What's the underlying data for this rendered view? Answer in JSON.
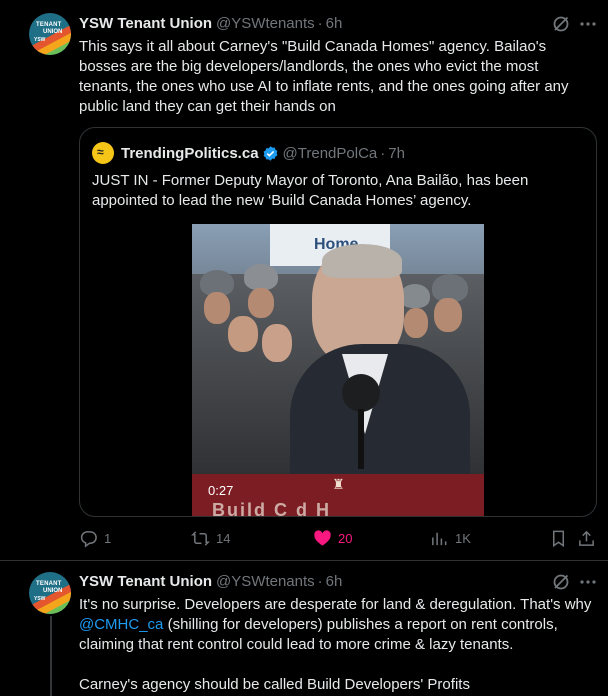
{
  "tweets": [
    {
      "author_name": "YSW Tenant Union",
      "handle": "@YSWtenants",
      "separator": "·",
      "time": "6h",
      "avatar_text": [
        "TENANT",
        "UNION",
        "YSW"
      ],
      "text": "This says it all about Carney's \"Build Canada Homes\" agency. Bailao's bosses are the big developers/landlords, the ones who evict the most tenants, the ones who use AI to inflate rents, and the ones going after any public land they can get their hands on",
      "quote": {
        "author_name": "TrendingPolitics.ca",
        "handle": "@TrendPolCa",
        "separator": "·",
        "time": "7h",
        "text": "JUST IN - Former Deputy Mayor of Toronto, Ana Bailão, has been appointed to lead the new ‘Build Canada Homes’ agency.",
        "video": {
          "duration": "0:27",
          "sign_text": "Home",
          "podium_text": "Build C  d  H"
        }
      },
      "actions": {
        "replies": "1",
        "reposts": "14",
        "likes": "20",
        "views": "1K"
      },
      "colors": {
        "like": "#f91880",
        "link": "#1d9bf0"
      },
      "icons": [
        "grok-icon",
        "more-icon",
        "reply-icon",
        "repost-icon",
        "heart-icon",
        "views-icon",
        "bookmark-icon",
        "share-icon",
        "verified-icon"
      ]
    },
    {
      "author_name": "YSW Tenant Union",
      "handle": "@YSWtenants",
      "separator": "·",
      "time": "6h",
      "avatar_text": [
        "TENANT",
        "UNION",
        "YSW"
      ],
      "text_before_mention": "It's no surprise. Developers are desperate for land & deregulation. That's why ",
      "mention": "@CMHC_ca",
      "text_after_mention": " (shilling for developers) publishes a report on rent controls, claiming that rent control could lead to more crime & lazy tenants.",
      "text_para2": "Carney's agency should be called Build Developers' Profits"
    }
  ]
}
